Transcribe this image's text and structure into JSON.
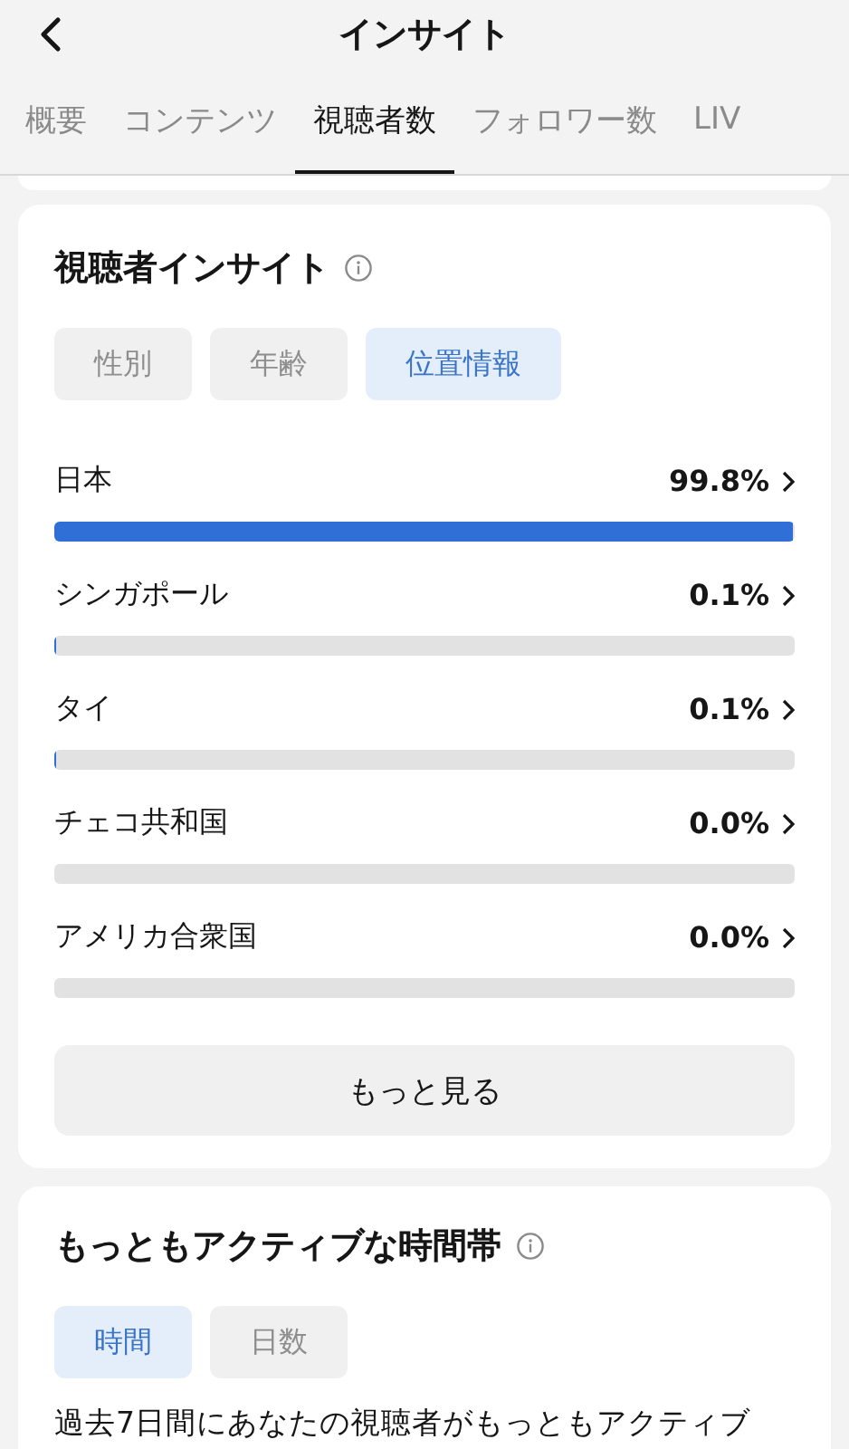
{
  "header": {
    "title": "インサイト"
  },
  "tabs": [
    {
      "label": "概要",
      "selected": false
    },
    {
      "label": "コンテンツ",
      "selected": false
    },
    {
      "label": "視聴者数",
      "selected": true
    },
    {
      "label": "フォロワー数",
      "selected": false
    },
    {
      "label": "LIV",
      "selected": false
    }
  ],
  "viewer_insights": {
    "title": "視聴者インサイト",
    "filters": [
      {
        "label": "性別",
        "selected": false
      },
      {
        "label": "年齢",
        "selected": false
      },
      {
        "label": "位置情報",
        "selected": true
      }
    ],
    "rows": [
      {
        "name": "日本",
        "value": "99.8%",
        "level": 0.998
      },
      {
        "name": "シンガポール",
        "value": "0.1%",
        "level": 0.001
      },
      {
        "name": "タイ",
        "value": "0.1%",
        "level": 0.001
      },
      {
        "name": "チェコ共和国",
        "value": "0.0%"
      },
      {
        "name": "アメリカ合衆国",
        "value": "0.0%"
      }
    ],
    "more_button": "もっと見る"
  },
  "active_times": {
    "title": "もっともアクティブな時間帯",
    "filters": [
      {
        "label": "時間",
        "selected": true
      },
      {
        "label": "日数",
        "selected": false
      }
    ],
    "description": "過去7日間にあなたの視聴者がもっともアクティブ"
  }
}
